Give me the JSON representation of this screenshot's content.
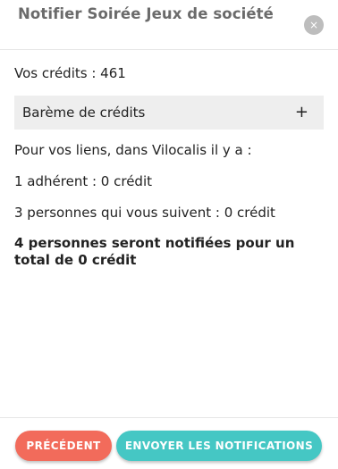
{
  "header": {
    "title": "Notifier Soirée Jeux de société",
    "close_icon": "×"
  },
  "credits": {
    "text": "Vos crédits : 461"
  },
  "accordion": {
    "label": "Barème de crédits",
    "toggle_icon": "+"
  },
  "details": {
    "intro": "Pour vos liens, dans Vilocalis il y a :",
    "members": "1 adhérent : 0 crédit",
    "followers": "3 personnes qui vous suivent : 0 crédit",
    "summary": "4 personnes seront notifiées pour un total de 0 crédit"
  },
  "footer": {
    "prev_label": "PRÉCÉDENT",
    "send_label": "ENVOYER LES NOTIFICATIONS"
  },
  "colors": {
    "prev_button": "#f26b5b",
    "send_button": "#45c7c4",
    "close_button": "#bdbdbd",
    "accordion_bg": "#eeeeee"
  }
}
